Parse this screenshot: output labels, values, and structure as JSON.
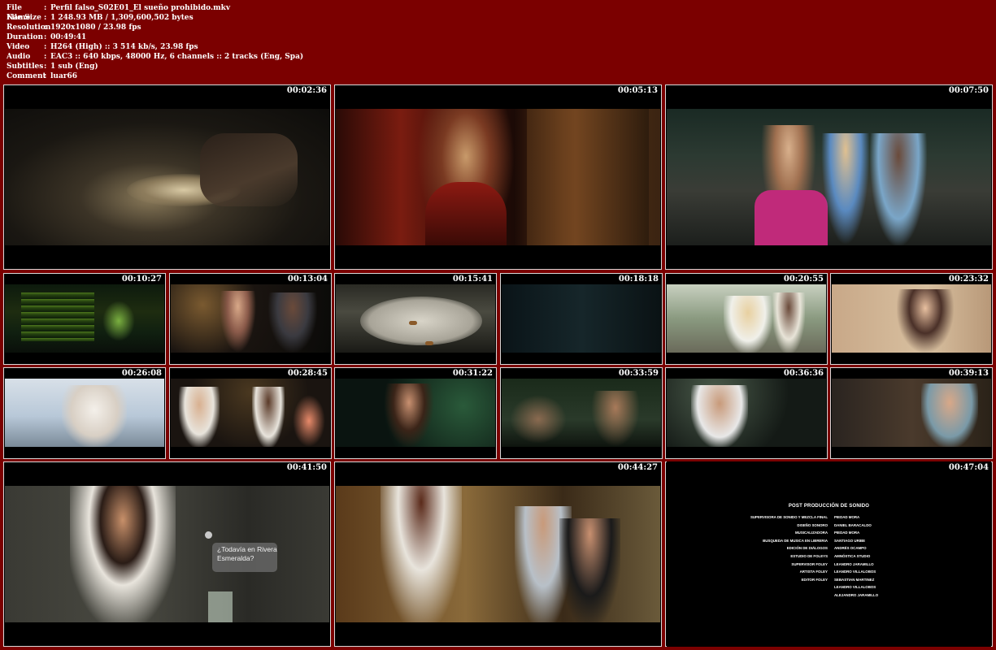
{
  "file_info": [
    {
      "key": "File Name",
      "value": "Perfil falso_S02E01_El sueño prohibido.mkv"
    },
    {
      "key": "File Size",
      "value": "1 248.93 MB  / 1,309,600,502  bytes"
    },
    {
      "key": "Resolution",
      "value": "1920x1080 / 23.98 fps"
    },
    {
      "key": "Duration",
      "value": "00:49:41"
    },
    {
      "key": "Video",
      "value": "H264 (High) :: 3 514 kb/s, 23.98 fps"
    },
    {
      "key": "Audio",
      "value": "EAC3 :: 640 kbps, 48000 Hz, 6 channels :: 2 tracks (Eng, Spa)"
    },
    {
      "key": "Subtitles",
      "value": "1 sub (Eng)"
    },
    {
      "key": "Comment",
      "value": "luar66"
    }
  ],
  "separator": ":",
  "thumbnails": [
    {
      "time": "00:02:36"
    },
    {
      "time": "00:05:13"
    },
    {
      "time": "00:07:50"
    },
    {
      "time": "00:10:27"
    },
    {
      "time": "00:13:04"
    },
    {
      "time": "00:15:41"
    },
    {
      "time": "00:18:18"
    },
    {
      "time": "00:20:55"
    },
    {
      "time": "00:23:32"
    },
    {
      "time": "00:26:08"
    },
    {
      "time": "00:28:45"
    },
    {
      "time": "00:31:22"
    },
    {
      "time": "00:33:59"
    },
    {
      "time": "00:36:36"
    },
    {
      "time": "00:39:13"
    },
    {
      "time": "00:41:50"
    },
    {
      "time": "00:44:27"
    },
    {
      "time": "00:47:04"
    }
  ],
  "subtitle_bubble": {
    "line1": "¿Todavía en Rivera",
    "line2": "Esmeralda?"
  },
  "credits": {
    "title": "POST PRODUCCIÓN DE SONIDO",
    "lines": [
      {
        "role": "SUPERVISORA DE SONIDO Y MEZCLA FINAL",
        "name": "PIEDAD MORA"
      },
      {
        "role": "DISEÑO SONORO",
        "name": "DANIEL BARACALDO"
      },
      {
        "role": "MUSICALIZADORA",
        "name": "PIEDAD MORA"
      },
      {
        "role": "BUSQUEDA DE MUSICA EN LIBRERIA",
        "name": "SANTIAGO URIBE"
      },
      {
        "role": "EDICIÓN DE DIÁLOGOS",
        "name": "ANDRÉS OCAMPO"
      },
      {
        "role": "ESTUDIO DE FOLEYS",
        "name": "AMNÓSTICA STUDIO"
      },
      {
        "role": "SUPERVISOR FOLEY",
        "name": "LEANDRO JARAMILLO"
      },
      {
        "role": "ARTISTA FOLEY",
        "name": "LEANDRO VILLALOBOS"
      },
      {
        "role": "EDITOR FOLEY",
        "name": "SEBASTIAN MARTINEZ"
      },
      {
        "role": "",
        "name": "LEANDRO VILLALOBOS"
      },
      {
        "role": "",
        "name": "ALEJANDRO JARAMILLO"
      }
    ]
  }
}
